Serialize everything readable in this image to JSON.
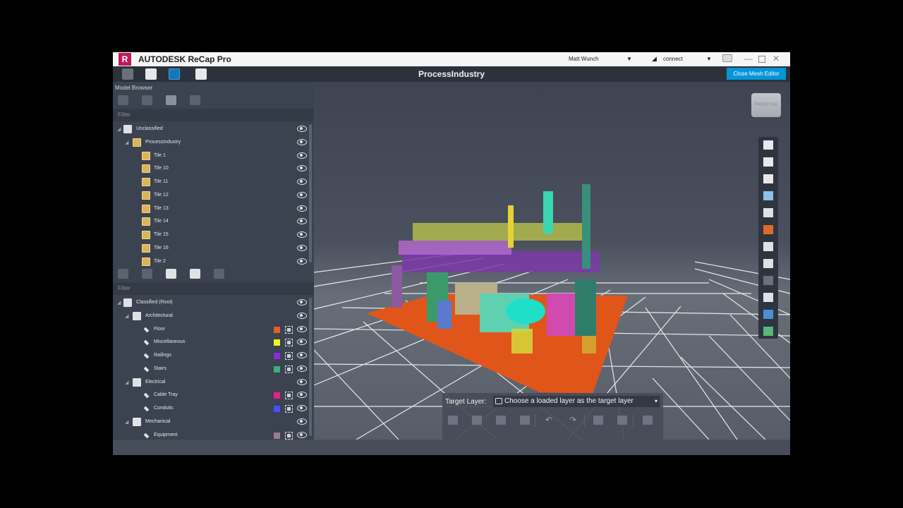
{
  "app": {
    "logo_letter": "R",
    "brand": "AUTODESK ReCap Pro",
    "user": "Matt Wunch",
    "connect": "connect",
    "document_title": "ProcessIndustry",
    "close_mesh_editor": "Close Mesh Editor"
  },
  "browser": {
    "title": "Model Browser",
    "filter_placeholder": "Filter",
    "unclassified": {
      "root": "Unclassified",
      "group": "ProcessIndustry",
      "tiles": [
        "Tile 1",
        "Tile 10",
        "Tile 11",
        "Tile 12",
        "Tile 13",
        "Tile 14",
        "Tile 15",
        "Tile 16",
        "Tile 2"
      ]
    },
    "classified": {
      "root": "Classified (Root)",
      "categories": [
        {
          "label": "Architectural",
          "items": [
            {
              "label": "Floor",
              "color": "#e0601f"
            },
            {
              "label": "Miscellaneous",
              "color": "#f4f21a"
            },
            {
              "label": "Railings",
              "color": "#8a2be2"
            },
            {
              "label": "Stairs",
              "color": "#3ab07a"
            }
          ]
        },
        {
          "label": "Electrical",
          "items": [
            {
              "label": "Cable Tray",
              "color": "#e91e8c"
            },
            {
              "label": "Conduits",
              "color": "#4c4cff"
            }
          ]
        },
        {
          "label": "Mechanical",
          "items": [
            {
              "label": "Equipment",
              "color": "#9b7c8c"
            }
          ]
        }
      ]
    }
  },
  "viewport": {
    "viewcube_label": "FRONT  RIG",
    "target_layer_label": "Target Layer:",
    "target_layer_value": "Choose a loaded layer as the target layer"
  }
}
